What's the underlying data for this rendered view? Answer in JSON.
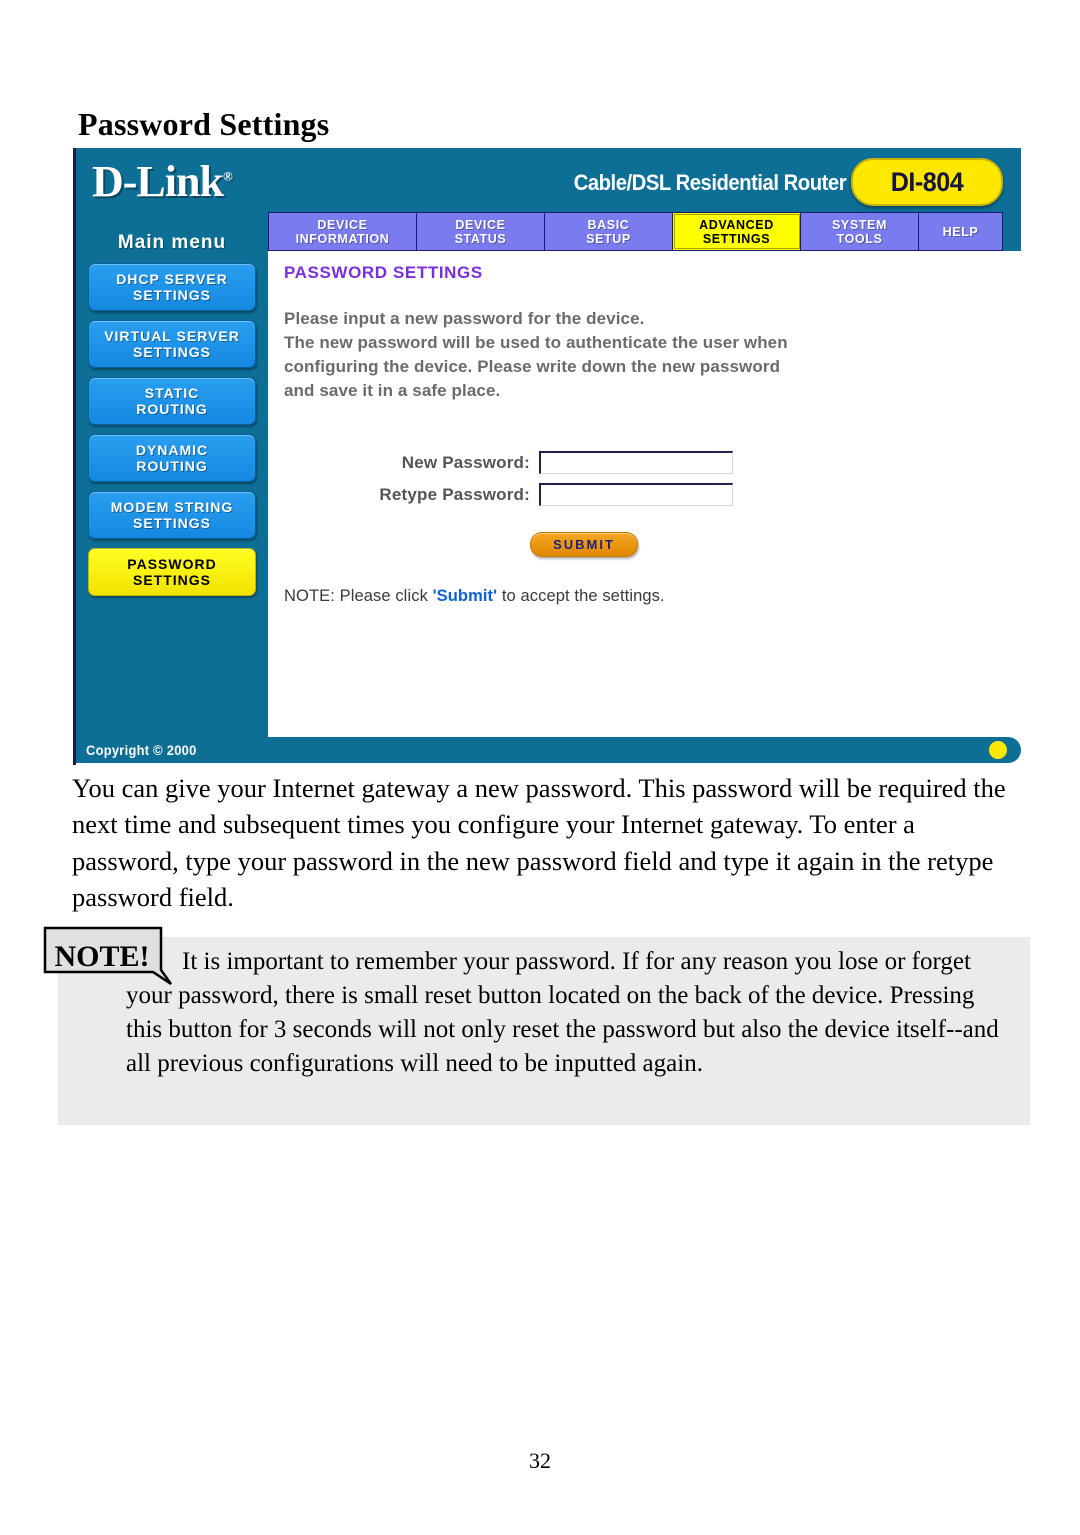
{
  "page": {
    "title": "Password Settings",
    "number": "32"
  },
  "router_ui": {
    "brand": "D-Link",
    "brand_tm": "®",
    "product_tagline": "Cable/DSL Residential Router",
    "model": "DI-804",
    "tabs": [
      {
        "label": "DEVICE INFORMATION",
        "line1": "DEVICE",
        "line2": "INFORMATION",
        "active": false
      },
      {
        "label": "DEVICE STATUS",
        "line1": "DEVICE",
        "line2": "STATUS",
        "active": false
      },
      {
        "label": "BASIC SETUP",
        "line1": "BASIC",
        "line2": "SETUP",
        "active": false
      },
      {
        "label": "ADVANCED SETTINGS",
        "line1": "ADVANCED",
        "line2": "SETTINGS",
        "active": true
      },
      {
        "label": "SYSTEM TOOLS",
        "line1": "SYSTEM",
        "line2": "TOOLS",
        "active": false
      },
      {
        "label": "HELP",
        "line1": "HELP",
        "line2": "",
        "active": false
      }
    ],
    "sidebar": {
      "title": "Main menu",
      "items": [
        {
          "line1": "DHCP SERVER",
          "line2": "SETTINGS",
          "active": false
        },
        {
          "line1": "VIRTUAL SERVER",
          "line2": "SETTINGS",
          "active": false
        },
        {
          "line1": "STATIC",
          "line2": "ROUTING",
          "active": false
        },
        {
          "line1": "DYNAMIC",
          "line2": "ROUTING",
          "active": false
        },
        {
          "line1": "MODEM STRING",
          "line2": "SETTINGS",
          "active": false
        },
        {
          "line1": "PASSWORD",
          "line2": "SETTINGS",
          "active": true
        }
      ]
    },
    "content": {
      "heading": "PASSWORD SETTINGS",
      "description_line1": "Please input a new password for the device.",
      "description_line2": "The new password will be used to authenticate the user when",
      "description_line3": "configuring the device. Please write down the new password",
      "description_line4": "and save it in a safe place.",
      "fields": [
        {
          "label": "New Password:",
          "value": "",
          "placeholder": ""
        },
        {
          "label": "Retype Password:",
          "value": "",
          "placeholder": ""
        }
      ],
      "submit_label": "SUBMIT",
      "note_prefix": "NOTE: Please click ",
      "note_highlight": "'Submit'",
      "note_suffix": " to accept the settings."
    },
    "footer": {
      "copyright": "Copyright © 2000",
      "indicator": "yellow-status-dot"
    },
    "colors": {
      "header_teal": "#0d6f96",
      "tab_blue": "#7b7bf0",
      "active_yellow": "#ffff00",
      "menu_blue": "#2a9ff0",
      "heading_purple": "#7a2ee0",
      "submit_orange": "#f5a623",
      "link_blue": "#0b63d6"
    }
  },
  "body_text": {
    "paragraph": "You can give your Internet gateway a new password. This password will be required the next time and subsequent times you configure your Internet gateway. To enter a password, type your password in the new password field and type it again in the retype password field."
  },
  "note_block": {
    "badge_label": "NOTE!",
    "text": "It is important to remember your password.  If for any reason you lose or forget your password, there is small reset button located on the back of the device.  Pressing this button for 3 seconds will not only reset the password but also the device itself--and all previous configurations will need to be inputted again."
  }
}
